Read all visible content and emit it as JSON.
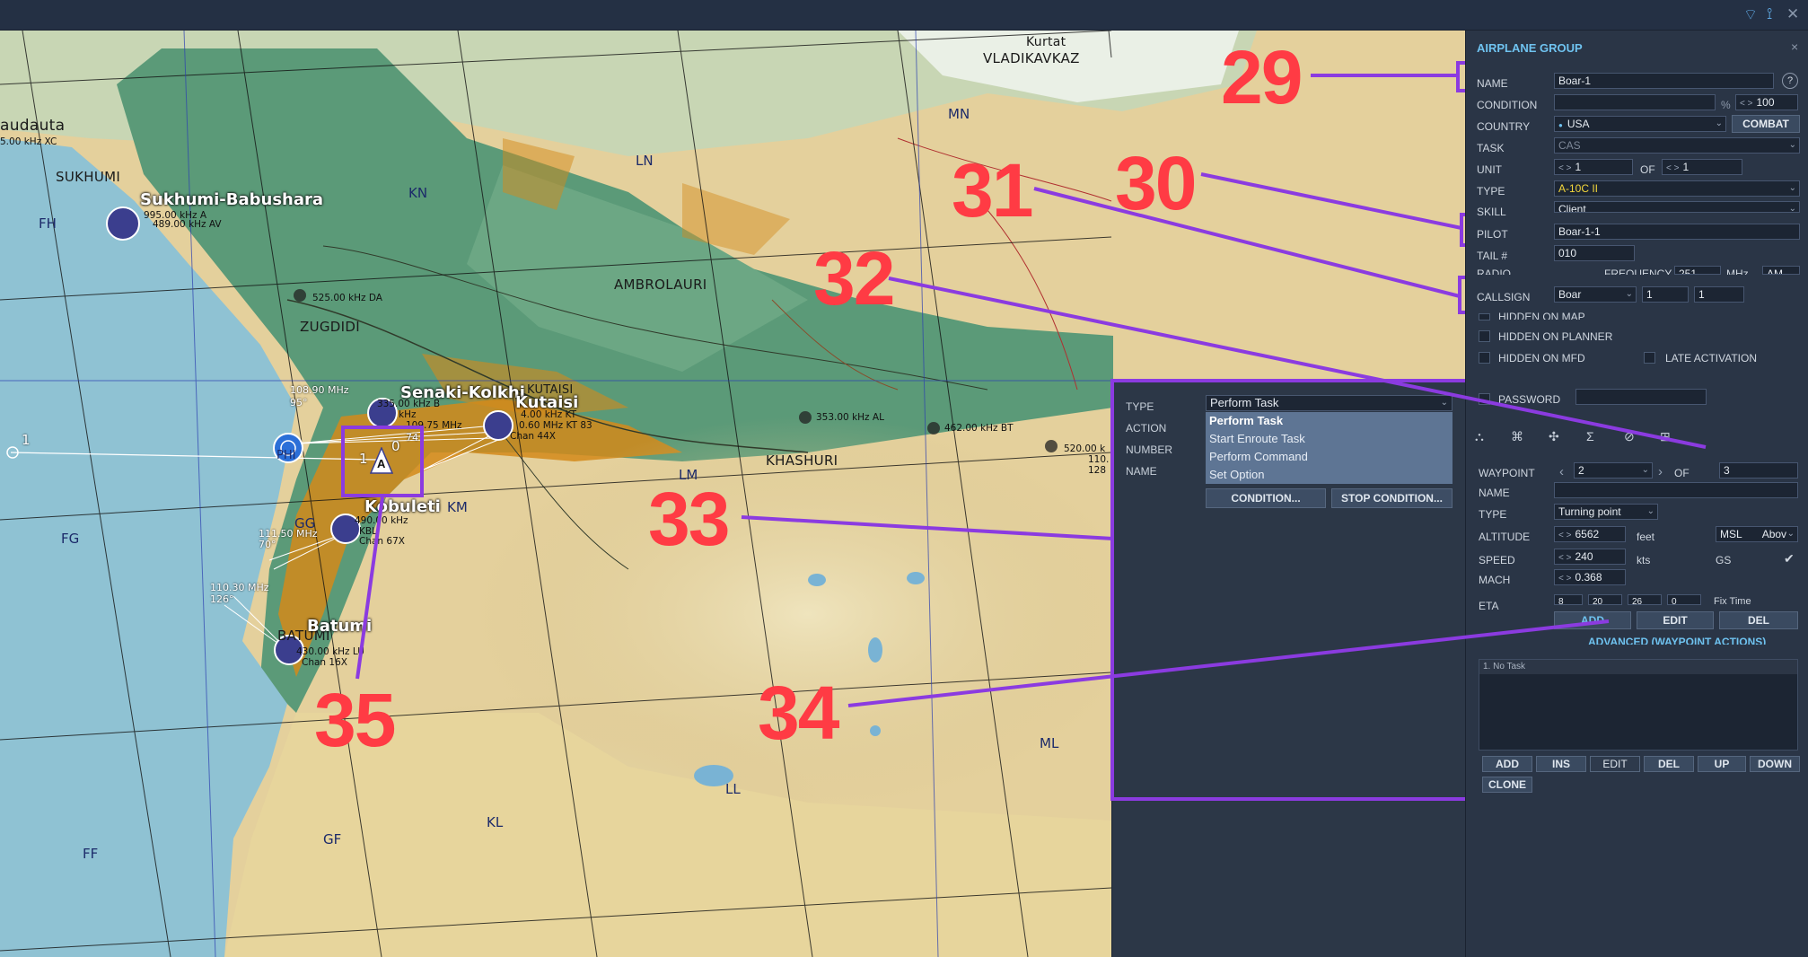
{
  "map": {
    "grid_labels": [
      "FH",
      "FG",
      "FF",
      "GF",
      "GG",
      "KN",
      "KM",
      "KL",
      "LN",
      "LM",
      "LL",
      "MN",
      "ML"
    ],
    "towns": [
      "SUKHUMI",
      "ZUGDIDI",
      "AMBROLAURI",
      "KHASHURI",
      "BATUMI",
      "KUTAISI",
      "VLADIKAVKAZ",
      "Kurtat",
      "audauta"
    ],
    "airfields": [
      "Sukhumi-Babushara",
      "Senaki-Kolkhi",
      "Kutaisi",
      "Kobuleti",
      "Batumi"
    ],
    "nav_labels": {
      "sukhumi_top": "995.00 kHz A",
      "sukhumi_bottom": "489.00 kHz AV",
      "zugdidi": "525.00 kHz DA",
      "senaki_freq": "108.90 MHz",
      "senaki_angle": "95°",
      "senaki_ndb": "335.00 kHz B",
      "senaki_ndb2": "kHz",
      "senaki_mhz": "109.75 MHz",
      "senaki_74": "74",
      "kutaisi_ndb": "4.00 kHz KT",
      "kutaisi_tac": "0.60 MHz KT 83",
      "kutaisi_chan": "Chan 44X",
      "kobuleti_freq": "111.50 MHz",
      "kobuleti_angle": "70°",
      "kobuleti_ndb": "490.00 kHz",
      "kobuleti_kbl": "KBL",
      "kobuleti_chan": "Chan 67X",
      "batumi_freq": "110.30 MHz",
      "batumi_angle": "126°",
      "batumi_ndb": "430.00 kHz LU",
      "batumi_chan": "Chan 16X",
      "al": "353.00 kHz AL",
      "khashuri_ndb": "462.00 kHz BT",
      "right_ndb": "520.00 k",
      "right_110": "110.",
      "right_128": "128",
      "left_kxc": "5.00 kHz XC",
      "route_1": "1",
      "wp_0": "0",
      "wp_1": "1",
      "phi": "PHI",
      "wp_marker": "A"
    }
  },
  "callouts": [
    "29",
    "30",
    "31",
    "32",
    "33",
    "34",
    "35"
  ],
  "action_dialog": {
    "labels": [
      "TYPE",
      "ACTION",
      "NUMBER",
      "NAME"
    ],
    "type_value": "Perform Task",
    "options": [
      "Perform Task",
      "Start Enroute Task",
      "Perform Command",
      "Set Option"
    ],
    "condition_btn": "CONDITION...",
    "stop_condition_btn": "STOP CONDITION..."
  },
  "panel": {
    "title": "AIRPLANE GROUP",
    "close": "×",
    "name_label": "NAME",
    "name_value": "Boar-1",
    "help": "?",
    "condition_label": "CONDITION",
    "condition_pct": "%",
    "condition_value": "100",
    "country_label": "COUNTRY",
    "country_value": "USA",
    "combat_btn": "COMBAT",
    "task_label": "TASK",
    "task_value": "CAS",
    "unit_label": "UNIT",
    "unit_value": "1",
    "of_label": "OF",
    "unit_of_value": "1",
    "type_label": "TYPE",
    "type_value": "A-10C II",
    "skill_label": "SKILL",
    "skill_value": "Client",
    "pilot_label": "PILOT",
    "pilot_value": "Boar-1-1",
    "tail_label": "TAIL #",
    "tail_value": "010",
    "radio_label": "RADIO",
    "frequency_label": "FREQUENCY",
    "frequency_value": "251",
    "mhz": "MHz",
    "am": "AM",
    "callsign_label": "CALLSIGN",
    "callsign_value": "Boar",
    "callsign_n1": "1",
    "callsign_n2": "1",
    "hidden_map": "HIDDEN ON MAP",
    "hidden_planner": "HIDDEN ON PLANNER",
    "hidden_mfd": "HIDDEN ON MFD",
    "late_activation": "LATE ACTIVATION",
    "password_label": "PASSWORD",
    "waypoint_label": "WAYPOINT",
    "waypoint_value": "2",
    "wp_of": "OF",
    "wp_total": "3",
    "wp_name_label": "NAME",
    "wp_type_label": "TYPE",
    "wp_type_value": "Turning point",
    "altitude_label": "ALTITUDE",
    "altitude_value": "6562",
    "feet": "feet",
    "msl": "MSL",
    "above": "Abov",
    "speed_label": "SPEED",
    "speed_value": "240",
    "kts": "kts",
    "gs": "GS",
    "gs_check": "✔",
    "mach_label": "MACH",
    "mach_value": "0.368",
    "eta_label": "ETA",
    "eta_vals": [
      "8",
      "20",
      "26",
      "0"
    ],
    "fix_time": "Fix Time",
    "add": "ADD",
    "edit": "EDIT",
    "del": "DEL",
    "advanced": "ADVANCED (WAYPOINT ACTIONS)",
    "task_list": [
      "1. No Task"
    ],
    "ins": "INS",
    "up": "UP",
    "down": "DOWN",
    "clone": "CLONE"
  },
  "colors": {
    "accent": "#6fc3f0",
    "callout": "#ff3b44",
    "highlight": "#8b3be0",
    "sea": "#8fc2d3",
    "lowland": "#5b9a78",
    "upland": "#e8d5a0"
  }
}
